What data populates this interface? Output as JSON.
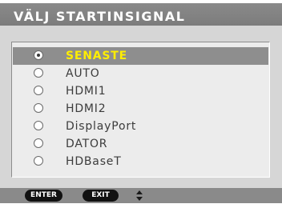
{
  "title": "VÄLJ STARTINSIGNAL",
  "options": [
    {
      "label": "SENASTE",
      "selected": true
    },
    {
      "label": "AUTO",
      "selected": false
    },
    {
      "label": "HDMI1",
      "selected": false
    },
    {
      "label": "HDMI2",
      "selected": false
    },
    {
      "label": "DisplayPort",
      "selected": false
    },
    {
      "label": "DATOR",
      "selected": false
    },
    {
      "label": "HDBaseT",
      "selected": false
    }
  ],
  "footer": {
    "enter_label": "ENTER",
    "exit_label": "EXIT",
    "navigate_icon": "up-down-arrow-icon"
  },
  "colors": {
    "selected_text": "#ffee00",
    "selected_background": "#8e8e8e",
    "title_bar": "#8a8a8a",
    "panel": "#d6d6d6"
  }
}
